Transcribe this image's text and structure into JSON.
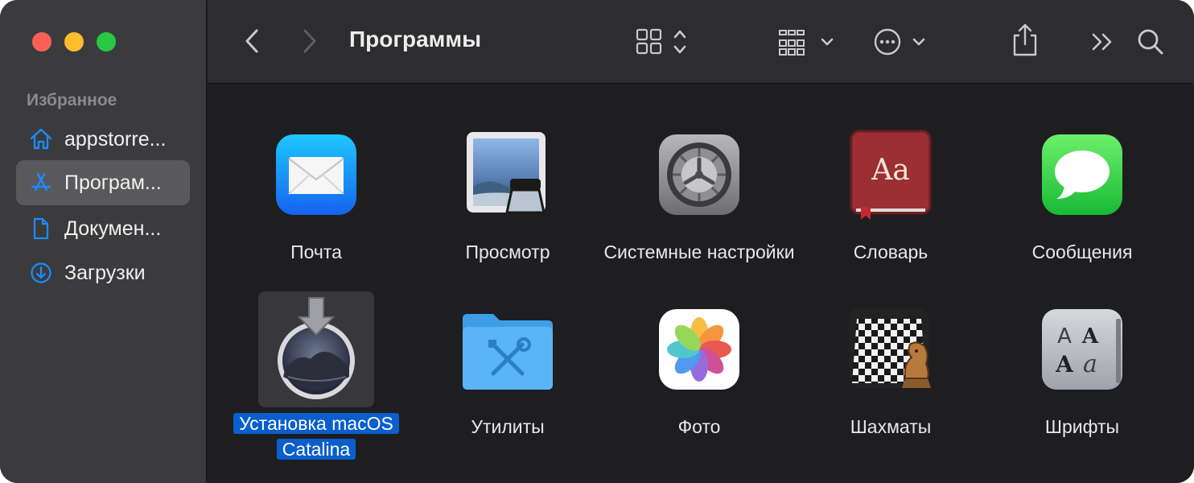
{
  "window": {
    "title": "Программы",
    "traffic_lights": {
      "close": "#fe5f57",
      "minimize": "#febc2e",
      "zoom": "#28c840"
    }
  },
  "sidebar": {
    "heading": "Избранное",
    "items": [
      {
        "label": "appstorre...",
        "icon": "home-icon",
        "selected": false
      },
      {
        "label": "Програм...",
        "icon": "applications-icon",
        "selected": true
      },
      {
        "label": "Докумен...",
        "icon": "document-icon",
        "selected": false
      },
      {
        "label": "Загрузки",
        "icon": "download-icon",
        "selected": false
      }
    ]
  },
  "toolbar": {
    "icons": [
      "back-icon",
      "forward-icon",
      "icon-view-icon",
      "group-icon",
      "more-actions-icon",
      "share-icon",
      "overflow-icon",
      "search-icon"
    ]
  },
  "apps": [
    {
      "label": "Почта",
      "icon": "mail-icon"
    },
    {
      "label": "Просмотр",
      "icon": "preview-icon"
    },
    {
      "label": "Системные настройки",
      "icon": "system-preferences-icon"
    },
    {
      "label": "Словарь",
      "icon": "dictionary-icon"
    },
    {
      "label": "Сообщения",
      "icon": "messages-icon"
    },
    {
      "label": "Установка macOS Catalina",
      "icon": "install-macos-icon",
      "selected": true
    },
    {
      "label": "Утилиты",
      "icon": "utilities-folder-icon"
    },
    {
      "label": "Фото",
      "icon": "photos-icon"
    },
    {
      "label": "Шахматы",
      "icon": "chess-icon"
    },
    {
      "label": "Шрифты",
      "icon": "font-book-icon"
    }
  ],
  "colors": {
    "selection": "#0a5ecd",
    "sidebar_accent": "#1b8cff",
    "sidebar_bg": "#3b3b3d",
    "content_bg": "#1e1e21"
  }
}
